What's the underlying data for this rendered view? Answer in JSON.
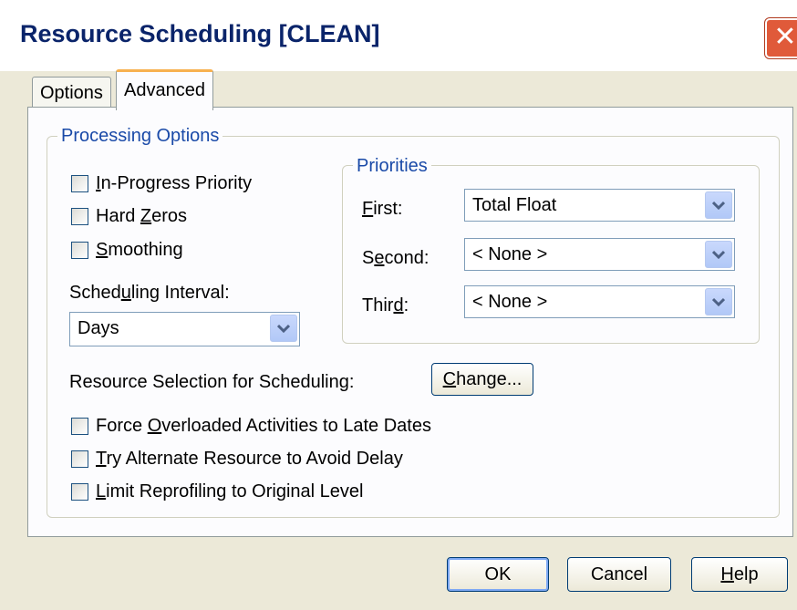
{
  "window": {
    "title": "Resource Scheduling [CLEAN]",
    "close_glyph": "✕"
  },
  "tabs": [
    {
      "label": "Options",
      "selected": false
    },
    {
      "label": "Advanced",
      "selected": true
    }
  ],
  "processing": {
    "legend": "Processing Options",
    "checkboxes": [
      {
        "label_html": "<u>I</u>n-Progress Priority",
        "text": "In-Progress Priority",
        "checked": false
      },
      {
        "label_html": "Hard <u>Z</u>eros",
        "text": "Hard Zeros",
        "checked": false
      },
      {
        "label_html": "<u>S</u>moothing",
        "text": "Smoothing",
        "checked": false
      }
    ],
    "interval_label": "Scheduling Interval:",
    "interval_value": "Days",
    "resource_selection_label": "Resource Selection for Scheduling:",
    "change_button": "Change...",
    "bottom_checkboxes": [
      {
        "text": "Force Overloaded Activities to Late Dates",
        "checked": false
      },
      {
        "text": "Try Alternate Resource to Avoid Delay",
        "checked": false
      },
      {
        "text": "Limit Reprofiling to Original Level",
        "checked": false
      }
    ]
  },
  "priorities": {
    "legend": "Priorities",
    "first_label": "First:",
    "first_value": "Total Float",
    "second_label": "Second:",
    "second_value": "< None >",
    "third_label": "Third:",
    "third_value": "< None >"
  },
  "buttons": {
    "ok": "OK",
    "cancel": "Cancel",
    "help": "Help"
  },
  "colors": {
    "accent_title": "#0a246a",
    "legend_blue": "#1a4aa8",
    "close_red": "#e05a3a",
    "tab_highlight": "#f7b14f"
  }
}
